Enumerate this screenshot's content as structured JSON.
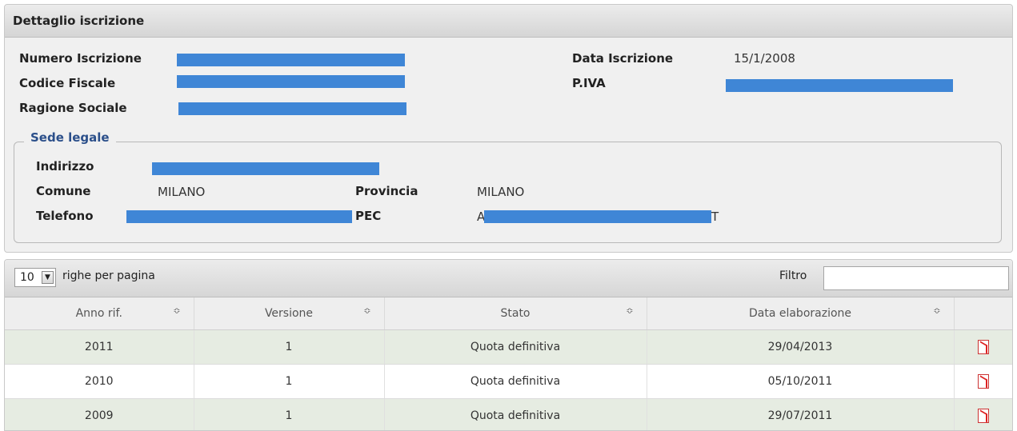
{
  "panel": {
    "title": "Dettaglio iscrizione",
    "fields": {
      "numero_iscrizione_label": "Numero Iscrizione",
      "codice_fiscale_label": "Codice Fiscale",
      "ragione_sociale_label": "Ragione Sociale",
      "data_iscrizione_label": "Data Iscrizione",
      "data_iscrizione_value": "15/1/2008",
      "piva_label": "P.IVA"
    },
    "sede": {
      "legend": "Sede legale",
      "indirizzo_label": "Indirizzo",
      "comune_label": "Comune",
      "comune_value": "MILANO",
      "provincia_label": "Provincia",
      "provincia_value": "MILANO",
      "telefono_label": "Telefono",
      "pec_label": "PEC",
      "pec_prefix": "A",
      "pec_suffix": "T"
    }
  },
  "grid": {
    "page_size": "10",
    "per_page_label": "righe per pagina",
    "filter_label": "Filtro",
    "filter_value": "",
    "columns": [
      "Anno rif.",
      "Versione",
      "Stato",
      "Data elaborazione"
    ],
    "sort_glyph": "≎",
    "rows": [
      {
        "anno": "2011",
        "versione": "1",
        "stato": "Quota definitiva",
        "data": "29/04/2013"
      },
      {
        "anno": "2010",
        "versione": "1",
        "stato": "Quota definitiva",
        "data": "05/10/2011"
      },
      {
        "anno": "2009",
        "versione": "1",
        "stato": "Quota definitiva",
        "data": "29/07/2011"
      }
    ],
    "row_icon": "pdf-icon"
  },
  "colors": {
    "redaction": "#3f86d6",
    "row_alt": "#e6ece2",
    "legend": "#2b4f8a"
  }
}
